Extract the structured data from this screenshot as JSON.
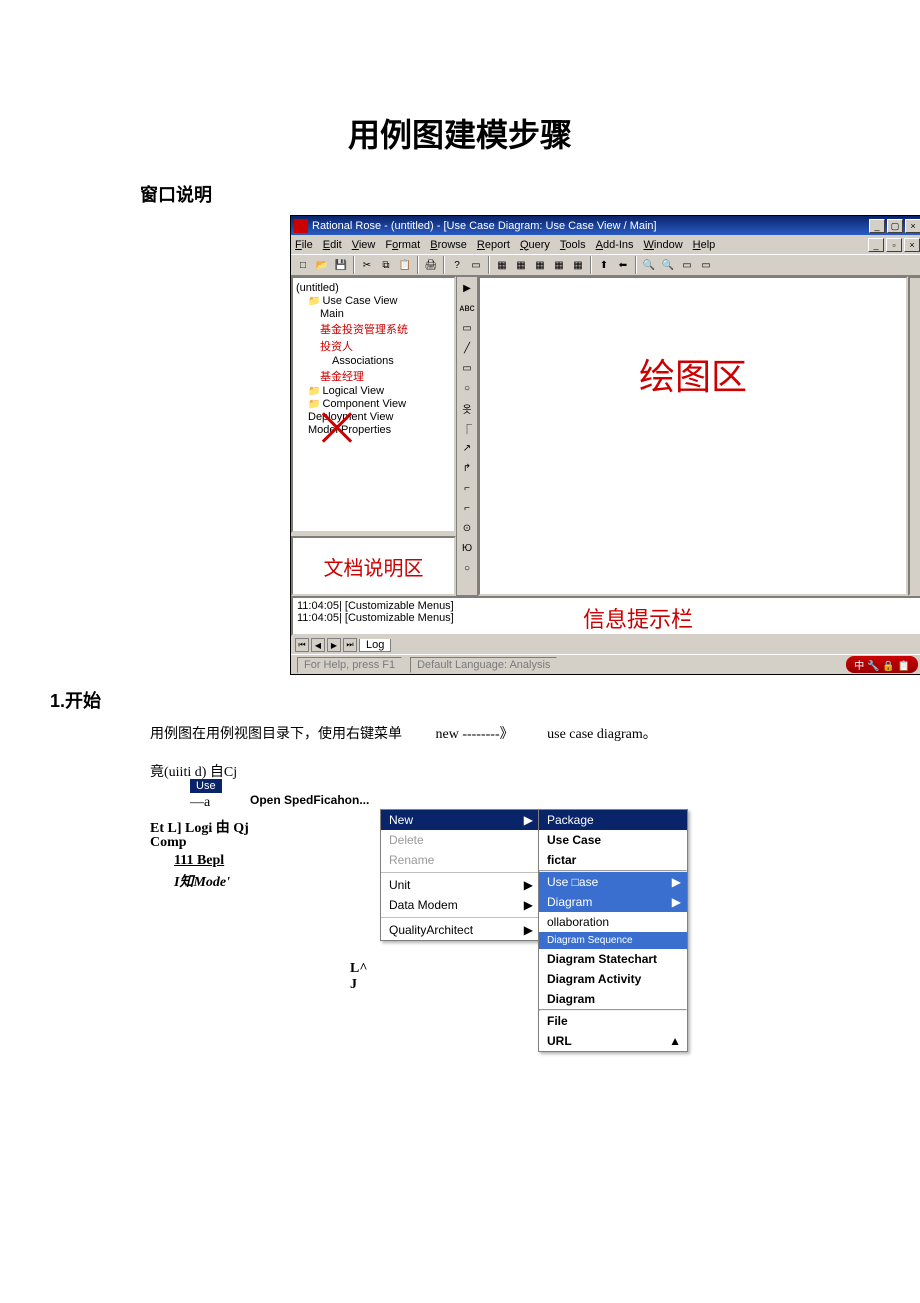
{
  "doc": {
    "title": "用例图建模步骤",
    "section_window": "窗口说明",
    "section_start": "1.开始",
    "start_text_a": "用例图在用例视图目录下，使用右键菜单",
    "start_text_b": "new --------》",
    "start_text_c": "use case diagram。"
  },
  "rose": {
    "titlebar": "Rational Rose - (untitled) - [Use Case Diagram: Use Case View / Main]",
    "menus": [
      "File",
      "Edit",
      "View",
      "Format",
      "Browse",
      "Report",
      "Query",
      "Tools",
      "Add-Ins",
      "Window",
      "Help"
    ],
    "tree": {
      "root": "(untitled)",
      "use_case_view": "Use Case View",
      "main": "Main",
      "item1": "基金投资管理系统",
      "item2": "投资人",
      "assoc": "Associations",
      "item3": "基金经理",
      "logical": "Logical View",
      "component": "Component View",
      "deployment": "Deployment View",
      "model_props": "Model Properties"
    },
    "annot_doc": "文档说明区",
    "annot_canvas": "绘图区",
    "annot_msg": "信息提示栏",
    "msg1": "11:04:05| [Customizable Menus]",
    "msg2": "11:04:05| [Customizable Menus]",
    "tab_log": "Log",
    "status_help": "For Help, press F1",
    "status_lang": "Default Language: Analysis",
    "status_ime": "中 🔧 🔒 📋"
  },
  "illust": {
    "line1": "竟(uiiti d) 自Cj",
    "use": "Use",
    "dash_a": "—a",
    "open_spec": "Open SpedFicahon...",
    "line2": "Et L] Logi 由  Qj",
    "comp": "Comp",
    "bepl": "111 Bepl",
    "mode": "I知Mode'",
    "lj": "L^\nJ",
    "cmenu": {
      "new": "New",
      "delete": "Delete",
      "rename": "Rename",
      "unit": "Unit",
      "data": "Data Modem",
      "quality": "QualityArchitect"
    },
    "submenu": {
      "package": "Package",
      "use_case": "Use Case",
      "fictar": "fictar",
      "use_ease": "Use □ase",
      "diagram": "Diagram",
      "collab": "ollaboration",
      "diag_seq": "Diagram Sequence",
      "diag_state": "Diagram Statechart",
      "diag_act": "Diagram Activity",
      "diag": "Diagram",
      "file": "File",
      "url": "URL"
    }
  }
}
